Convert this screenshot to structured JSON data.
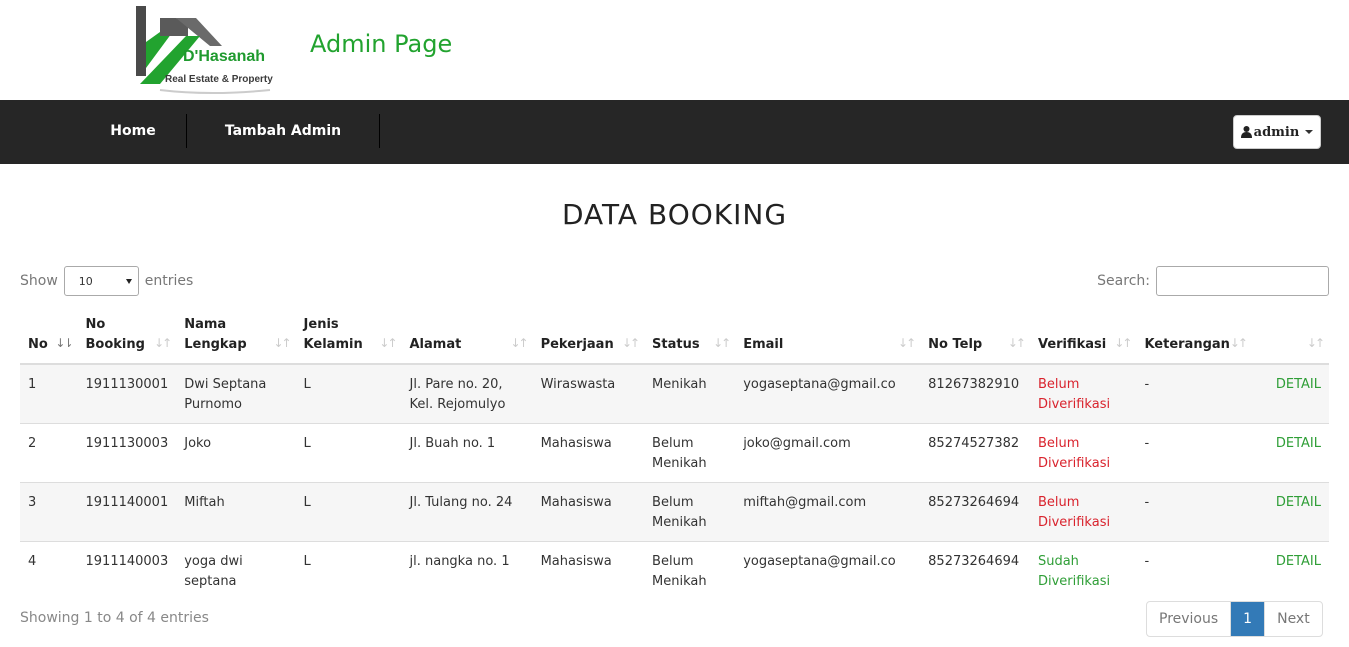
{
  "brand": {
    "logo_name": "D'Hasanah",
    "logo_tagline": "Real Estate & Property",
    "page_heading": "Admin Page"
  },
  "nav": {
    "home": "Home",
    "tambah_admin": "Tambah Admin",
    "user_label": "admin"
  },
  "title": "DATA BOOKING",
  "controls": {
    "show_label": "Show",
    "entries_label": "entries",
    "length_value": "10",
    "search_label": "Search:",
    "search_value": ""
  },
  "table": {
    "headers": [
      "No",
      "No Booking",
      "Nama Lengkap",
      "Jenis Kelamin",
      "Alamat",
      "Pekerjaan",
      "Status",
      "Email",
      "No Telp",
      "Verifikasi",
      "Keterangan",
      ""
    ],
    "rows": [
      {
        "no": "1",
        "booking": "1911130001",
        "nama": "Dwi Septana Purnomo",
        "jk": "L",
        "alamat": "Jl. Pare no. 20, Kel. Rejomulyo",
        "pekerjaan": "Wiraswasta",
        "status": "Menikah",
        "email": "yogaseptana@gmail.co",
        "telp": "81267382910",
        "verifikasi": "Belum Diverifikasi",
        "keterangan": "-",
        "action": "DETAIL"
      },
      {
        "no": "2",
        "booking": "1911130003",
        "nama": "Joko",
        "jk": "L",
        "alamat": "Jl. Buah no. 1",
        "pekerjaan": "Mahasiswa",
        "status": "Belum Menikah",
        "email": "joko@gmail.com",
        "telp": "85274527382",
        "verifikasi": "Belum Diverifikasi",
        "keterangan": "-",
        "action": "DETAIL"
      },
      {
        "no": "3",
        "booking": "1911140001",
        "nama": "Miftah",
        "jk": "L",
        "alamat": "Jl. Tulang no. 24",
        "pekerjaan": "Mahasiswa",
        "status": "Belum Menikah",
        "email": "miftah@gmail.com",
        "telp": "85273264694",
        "verifikasi": "Belum Diverifikasi",
        "keterangan": "-",
        "action": "DETAIL"
      },
      {
        "no": "4",
        "booking": "1911140003",
        "nama": "yoga dwi septana",
        "jk": "L",
        "alamat": "jl. nangka no. 1",
        "pekerjaan": "Mahasiswa",
        "status": "Belum Menikah",
        "email": "yogaseptana@gmail.co",
        "telp": "85273264694",
        "verifikasi": "Sudah Diverifikasi",
        "keterangan": "-",
        "action": "DETAIL"
      }
    ]
  },
  "footer": {
    "info": "Showing 1 to 4 of 4 entries",
    "previous": "Previous",
    "current_page": "1",
    "next": "Next"
  },
  "colors": {
    "brand_green": "#22a32f",
    "navbar": "#262626",
    "unverified": "#d9232d",
    "verified": "#2f9e37",
    "page_active": "#337ab7"
  }
}
